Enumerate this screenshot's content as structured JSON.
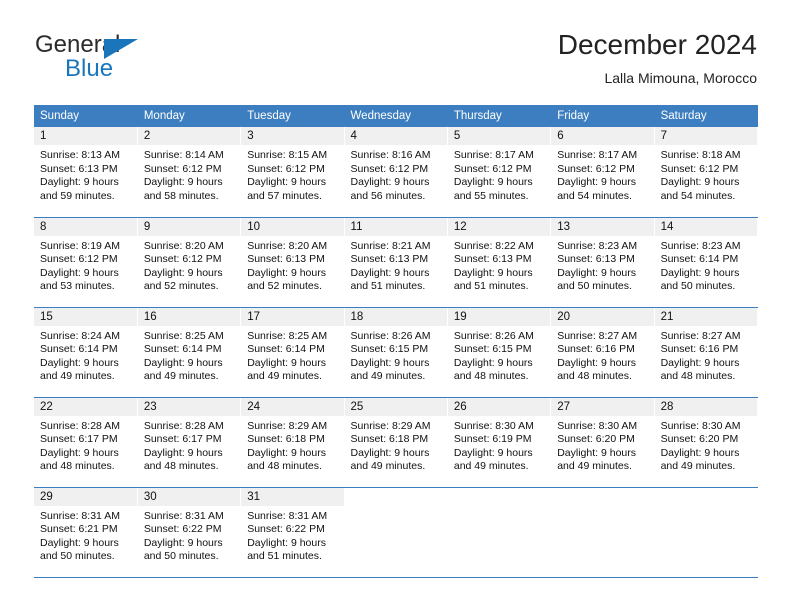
{
  "brand": {
    "name_part1": "General",
    "name_part2": "Blue",
    "accent_color": "#1b75bb",
    "triangle_icon": "triangle-icon"
  },
  "header": {
    "title": "December 2024",
    "subtitle": "Lalla Mimouna, Morocco"
  },
  "calendar": {
    "header_background": "#3c7ebf",
    "daynum_background": "#f0f0f0",
    "weekdays": [
      "Sunday",
      "Monday",
      "Tuesday",
      "Wednesday",
      "Thursday",
      "Friday",
      "Saturday"
    ],
    "weeks": [
      [
        {
          "day": "1",
          "sunrise": "Sunrise: 8:13 AM",
          "sunset": "Sunset: 6:13 PM",
          "daylight_line1": "Daylight: 9 hours",
          "daylight_line2": "and 59 minutes."
        },
        {
          "day": "2",
          "sunrise": "Sunrise: 8:14 AM",
          "sunset": "Sunset: 6:12 PM",
          "daylight_line1": "Daylight: 9 hours",
          "daylight_line2": "and 58 minutes."
        },
        {
          "day": "3",
          "sunrise": "Sunrise: 8:15 AM",
          "sunset": "Sunset: 6:12 PM",
          "daylight_line1": "Daylight: 9 hours",
          "daylight_line2": "and 57 minutes."
        },
        {
          "day": "4",
          "sunrise": "Sunrise: 8:16 AM",
          "sunset": "Sunset: 6:12 PM",
          "daylight_line1": "Daylight: 9 hours",
          "daylight_line2": "and 56 minutes."
        },
        {
          "day": "5",
          "sunrise": "Sunrise: 8:17 AM",
          "sunset": "Sunset: 6:12 PM",
          "daylight_line1": "Daylight: 9 hours",
          "daylight_line2": "and 55 minutes."
        },
        {
          "day": "6",
          "sunrise": "Sunrise: 8:17 AM",
          "sunset": "Sunset: 6:12 PM",
          "daylight_line1": "Daylight: 9 hours",
          "daylight_line2": "and 54 minutes."
        },
        {
          "day": "7",
          "sunrise": "Sunrise: 8:18 AM",
          "sunset": "Sunset: 6:12 PM",
          "daylight_line1": "Daylight: 9 hours",
          "daylight_line2": "and 54 minutes."
        }
      ],
      [
        {
          "day": "8",
          "sunrise": "Sunrise: 8:19 AM",
          "sunset": "Sunset: 6:12 PM",
          "daylight_line1": "Daylight: 9 hours",
          "daylight_line2": "and 53 minutes."
        },
        {
          "day": "9",
          "sunrise": "Sunrise: 8:20 AM",
          "sunset": "Sunset: 6:12 PM",
          "daylight_line1": "Daylight: 9 hours",
          "daylight_line2": "and 52 minutes."
        },
        {
          "day": "10",
          "sunrise": "Sunrise: 8:20 AM",
          "sunset": "Sunset: 6:13 PM",
          "daylight_line1": "Daylight: 9 hours",
          "daylight_line2": "and 52 minutes."
        },
        {
          "day": "11",
          "sunrise": "Sunrise: 8:21 AM",
          "sunset": "Sunset: 6:13 PM",
          "daylight_line1": "Daylight: 9 hours",
          "daylight_line2": "and 51 minutes."
        },
        {
          "day": "12",
          "sunrise": "Sunrise: 8:22 AM",
          "sunset": "Sunset: 6:13 PM",
          "daylight_line1": "Daylight: 9 hours",
          "daylight_line2": "and 51 minutes."
        },
        {
          "day": "13",
          "sunrise": "Sunrise: 8:23 AM",
          "sunset": "Sunset: 6:13 PM",
          "daylight_line1": "Daylight: 9 hours",
          "daylight_line2": "and 50 minutes."
        },
        {
          "day": "14",
          "sunrise": "Sunrise: 8:23 AM",
          "sunset": "Sunset: 6:14 PM",
          "daylight_line1": "Daylight: 9 hours",
          "daylight_line2": "and 50 minutes."
        }
      ],
      [
        {
          "day": "15",
          "sunrise": "Sunrise: 8:24 AM",
          "sunset": "Sunset: 6:14 PM",
          "daylight_line1": "Daylight: 9 hours",
          "daylight_line2": "and 49 minutes."
        },
        {
          "day": "16",
          "sunrise": "Sunrise: 8:25 AM",
          "sunset": "Sunset: 6:14 PM",
          "daylight_line1": "Daylight: 9 hours",
          "daylight_line2": "and 49 minutes."
        },
        {
          "day": "17",
          "sunrise": "Sunrise: 8:25 AM",
          "sunset": "Sunset: 6:14 PM",
          "daylight_line1": "Daylight: 9 hours",
          "daylight_line2": "and 49 minutes."
        },
        {
          "day": "18",
          "sunrise": "Sunrise: 8:26 AM",
          "sunset": "Sunset: 6:15 PM",
          "daylight_line1": "Daylight: 9 hours",
          "daylight_line2": "and 49 minutes."
        },
        {
          "day": "19",
          "sunrise": "Sunrise: 8:26 AM",
          "sunset": "Sunset: 6:15 PM",
          "daylight_line1": "Daylight: 9 hours",
          "daylight_line2": "and 48 minutes."
        },
        {
          "day": "20",
          "sunrise": "Sunrise: 8:27 AM",
          "sunset": "Sunset: 6:16 PM",
          "daylight_line1": "Daylight: 9 hours",
          "daylight_line2": "and 48 minutes."
        },
        {
          "day": "21",
          "sunrise": "Sunrise: 8:27 AM",
          "sunset": "Sunset: 6:16 PM",
          "daylight_line1": "Daylight: 9 hours",
          "daylight_line2": "and 48 minutes."
        }
      ],
      [
        {
          "day": "22",
          "sunrise": "Sunrise: 8:28 AM",
          "sunset": "Sunset: 6:17 PM",
          "daylight_line1": "Daylight: 9 hours",
          "daylight_line2": "and 48 minutes."
        },
        {
          "day": "23",
          "sunrise": "Sunrise: 8:28 AM",
          "sunset": "Sunset: 6:17 PM",
          "daylight_line1": "Daylight: 9 hours",
          "daylight_line2": "and 48 minutes."
        },
        {
          "day": "24",
          "sunrise": "Sunrise: 8:29 AM",
          "sunset": "Sunset: 6:18 PM",
          "daylight_line1": "Daylight: 9 hours",
          "daylight_line2": "and 48 minutes."
        },
        {
          "day": "25",
          "sunrise": "Sunrise: 8:29 AM",
          "sunset": "Sunset: 6:18 PM",
          "daylight_line1": "Daylight: 9 hours",
          "daylight_line2": "and 49 minutes."
        },
        {
          "day": "26",
          "sunrise": "Sunrise: 8:30 AM",
          "sunset": "Sunset: 6:19 PM",
          "daylight_line1": "Daylight: 9 hours",
          "daylight_line2": "and 49 minutes."
        },
        {
          "day": "27",
          "sunrise": "Sunrise: 8:30 AM",
          "sunset": "Sunset: 6:20 PM",
          "daylight_line1": "Daylight: 9 hours",
          "daylight_line2": "and 49 minutes."
        },
        {
          "day": "28",
          "sunrise": "Sunrise: 8:30 AM",
          "sunset": "Sunset: 6:20 PM",
          "daylight_line1": "Daylight: 9 hours",
          "daylight_line2": "and 49 minutes."
        }
      ],
      [
        {
          "day": "29",
          "sunrise": "Sunrise: 8:31 AM",
          "sunset": "Sunset: 6:21 PM",
          "daylight_line1": "Daylight: 9 hours",
          "daylight_line2": "and 50 minutes."
        },
        {
          "day": "30",
          "sunrise": "Sunrise: 8:31 AM",
          "sunset": "Sunset: 6:22 PM",
          "daylight_line1": "Daylight: 9 hours",
          "daylight_line2": "and 50 minutes."
        },
        {
          "day": "31",
          "sunrise": "Sunrise: 8:31 AM",
          "sunset": "Sunset: 6:22 PM",
          "daylight_line1": "Daylight: 9 hours",
          "daylight_line2": "and 51 minutes."
        },
        {
          "day": "",
          "sunrise": "",
          "sunset": "",
          "daylight_line1": "",
          "daylight_line2": ""
        },
        {
          "day": "",
          "sunrise": "",
          "sunset": "",
          "daylight_line1": "",
          "daylight_line2": ""
        },
        {
          "day": "",
          "sunrise": "",
          "sunset": "",
          "daylight_line1": "",
          "daylight_line2": ""
        },
        {
          "day": "",
          "sunrise": "",
          "sunset": "",
          "daylight_line1": "",
          "daylight_line2": ""
        }
      ]
    ]
  }
}
